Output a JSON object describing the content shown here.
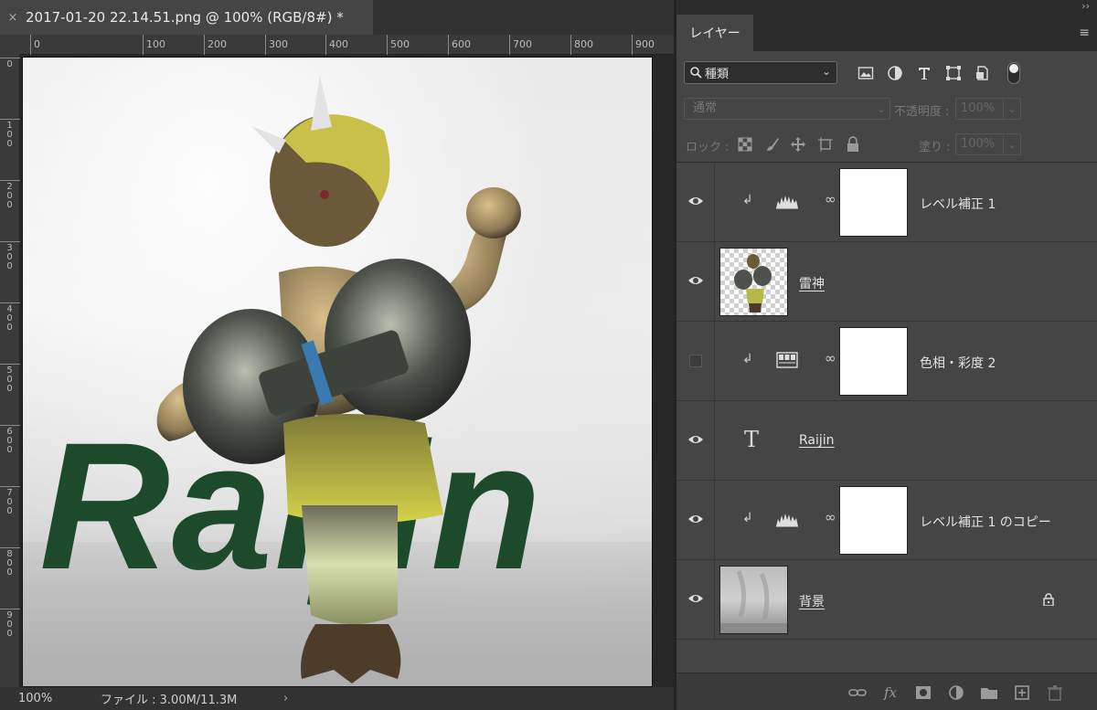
{
  "document": {
    "tab_title": "2017-01-20 22.14.51.png @ 100% (RGB/8#) *",
    "close_glyph": "×",
    "ruler_h_labels": [
      "0",
      "100",
      "200",
      "300",
      "400",
      "500",
      "600",
      "700",
      "800",
      "900",
      "100"
    ],
    "ruler_v_labels": [
      "0",
      "100",
      "200",
      "300",
      "400",
      "500",
      "600",
      "700",
      "800",
      "900"
    ],
    "canvas_text": "Raijin",
    "status": {
      "zoom": "100%",
      "file_info": "ファイル : 3.00M/11.3M",
      "arrow": "›"
    }
  },
  "panel": {
    "collapse_glyph": "››",
    "tab_layers": "レイヤー",
    "menu_glyph": "≡",
    "filter": {
      "value": "種類",
      "chevron": "⌄"
    },
    "filter_icons": [
      "image-filter-icon",
      "adjustment-filter-icon",
      "type-filter-icon",
      "shape-filter-icon",
      "smartobject-filter-icon"
    ],
    "blend": {
      "mode": "通常",
      "opacity_label": "不透明度 :",
      "opacity_value": "100%"
    },
    "lock": {
      "label": "ロック :",
      "fill_label": "塗り :",
      "fill_value": "100%"
    },
    "layers": [
      {
        "name": "レベル補正 1",
        "visible": true,
        "type": "levels",
        "clipped": true
      },
      {
        "name": "雷神",
        "visible": true,
        "type": "pixel",
        "clipped": false
      },
      {
        "name": "色相・彩度 2",
        "visible": false,
        "type": "hue-saturation",
        "clipped": true
      },
      {
        "name": "Raijin",
        "visible": true,
        "type": "text",
        "clipped": false
      },
      {
        "name": "レベル補正 1 のコピー",
        "visible": true,
        "type": "levels",
        "clipped": true
      },
      {
        "name": "背景",
        "visible": true,
        "type": "background",
        "locked": true
      }
    ],
    "footer_icons": [
      "link-layers-icon",
      "fx-icon",
      "add-mask-icon",
      "new-adjustment-icon",
      "new-group-icon",
      "new-layer-icon",
      "trash-icon"
    ],
    "fx_label": "fx",
    "text_glyph": "T",
    "clip_glyph": "↲"
  },
  "colors": {
    "canvas_text": "#1d4a2a",
    "panel_bg": "#454545",
    "app_bg": "#282828"
  }
}
